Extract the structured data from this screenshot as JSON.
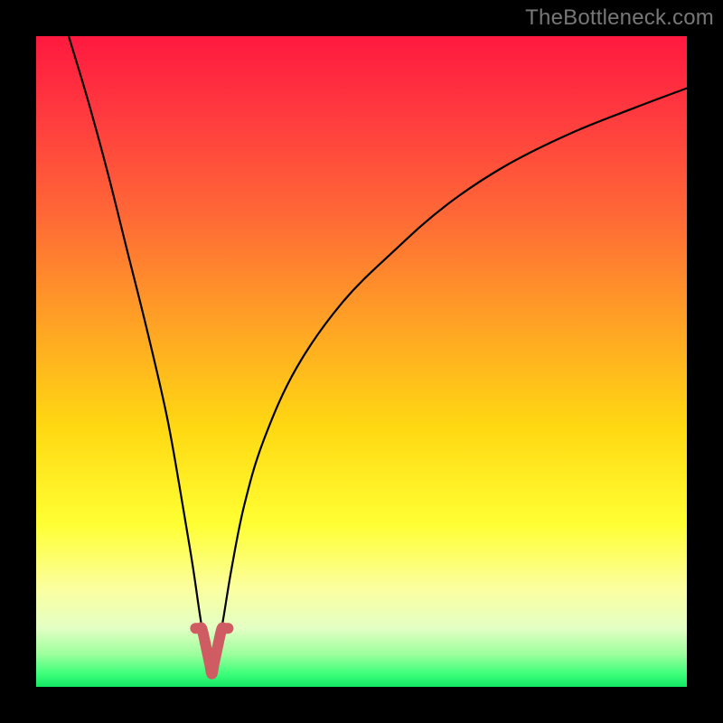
{
  "watermark": {
    "text": "TheBottleneck.com"
  },
  "colors": {
    "black": "#000000",
    "curve": "#000000",
    "highlight": "#cf5b63",
    "gradient_stops": [
      {
        "pct": 0,
        "color": "#ff193f"
      },
      {
        "pct": 12,
        "color": "#ff3a3f"
      },
      {
        "pct": 28,
        "color": "#ff6a36"
      },
      {
        "pct": 45,
        "color": "#ffa524"
      },
      {
        "pct": 60,
        "color": "#ffd812"
      },
      {
        "pct": 75,
        "color": "#ffff33"
      },
      {
        "pct": 85,
        "color": "#fbffa0"
      },
      {
        "pct": 91,
        "color": "#e3ffc4"
      },
      {
        "pct": 95,
        "color": "#9cff9c"
      },
      {
        "pct": 98,
        "color": "#3dff7a"
      },
      {
        "pct": 100,
        "color": "#13e864"
      }
    ]
  },
  "chart_data": {
    "type": "line",
    "title": "",
    "xlabel": "",
    "ylabel": "",
    "xlim": [
      0,
      100
    ],
    "ylim": [
      0,
      100
    ],
    "optimum_x": 27,
    "series": [
      {
        "name": "bottleneck-curve",
        "x": [
          5,
          8,
          11,
          14,
          17,
          20,
          22,
          24,
          25.5,
          27,
          28.5,
          30,
          32,
          35,
          40,
          47,
          55,
          63,
          72,
          82,
          92,
          100
        ],
        "values": [
          100,
          90,
          79,
          67,
          55,
          42,
          31,
          19,
          9,
          2,
          9,
          18,
          28,
          38,
          49,
          59,
          67,
          74,
          80,
          85,
          89,
          92
        ]
      }
    ],
    "highlight_region": {
      "x_start": 24.5,
      "x_end": 29.5,
      "y_max": 9
    }
  }
}
